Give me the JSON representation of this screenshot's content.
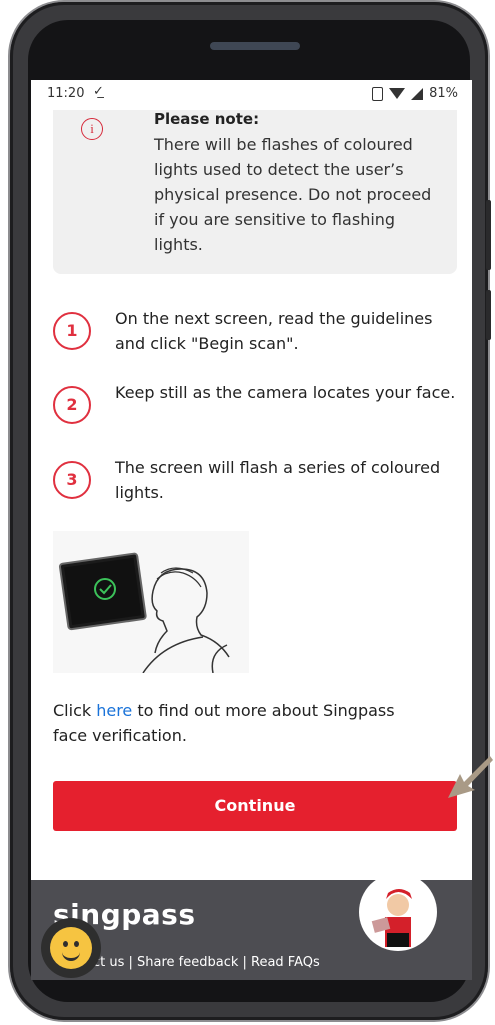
{
  "status_bar": {
    "time": "11:20",
    "battery": "81%"
  },
  "notice": {
    "title": "Please note:",
    "body": "There will be flashes of coloured lights used to detect the user’s physical presence. Do not proceed if you are sensitive to flashing lights."
  },
  "steps": [
    {
      "number": "1",
      "text": "On the next screen, read the guidelines and click \"Begin scan\"."
    },
    {
      "number": "2",
      "text": "Keep still as the camera locates your face."
    },
    {
      "number": "3",
      "text": "The screen will flash a series of coloured lights."
    }
  ],
  "more_info": {
    "prefix": "Click",
    "link": "here",
    "suffix": " to find out more about Singpass face verification."
  },
  "continue_label": "Continue",
  "footer": {
    "brand": "singpass",
    "links": "act us | Share feedback | Read FAQs"
  },
  "colors": {
    "accent": "#e5202e",
    "footer_bg": "#4d4d52",
    "link": "#1a73d9"
  }
}
